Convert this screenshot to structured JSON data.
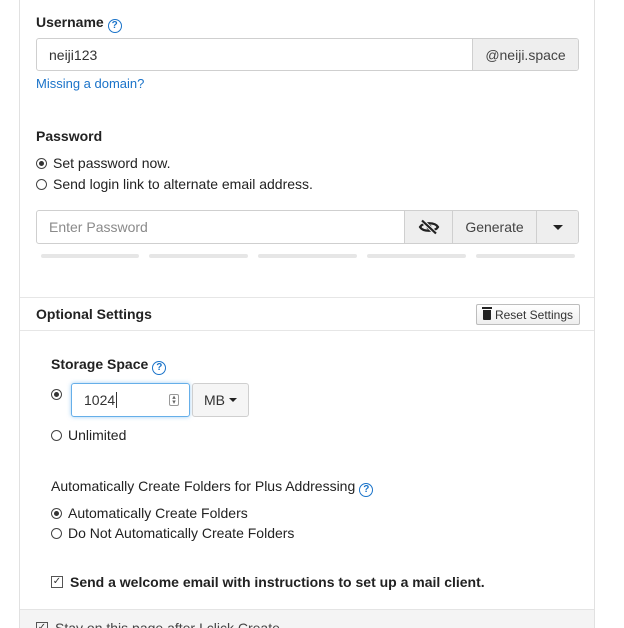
{
  "username": {
    "label": "Username",
    "value": "neiji123",
    "domain": "@neiji.space",
    "missing_domain_link": "Missing a domain?"
  },
  "password": {
    "label": "Password",
    "options": [
      {
        "label": "Set password now.",
        "checked": true
      },
      {
        "label": "Send login link to alternate email address.",
        "checked": false
      }
    ],
    "placeholder": "Enter Password",
    "generate_label": "Generate",
    "strength_segments": 5
  },
  "optional": {
    "title": "Optional Settings",
    "reset_label": "Reset Settings"
  },
  "storage": {
    "label": "Storage Space",
    "value": "1024",
    "unit": "MB",
    "unlimited_label": "Unlimited"
  },
  "plus_addressing": {
    "label": "Automatically Create Folders for Plus Addressing",
    "options": [
      {
        "label": "Automatically Create Folders",
        "checked": true
      },
      {
        "label": "Do Not Automatically Create Folders",
        "checked": false
      }
    ]
  },
  "welcome_email": {
    "label": "Send a welcome email with instructions to set up a mail client.",
    "checked": true
  },
  "stay_on_page": {
    "label": "Stay on this page after I click Create"
  },
  "colors": {
    "link": "#1a73c9",
    "border": "#cfcfcf",
    "addon_bg": "#eeeeee"
  }
}
